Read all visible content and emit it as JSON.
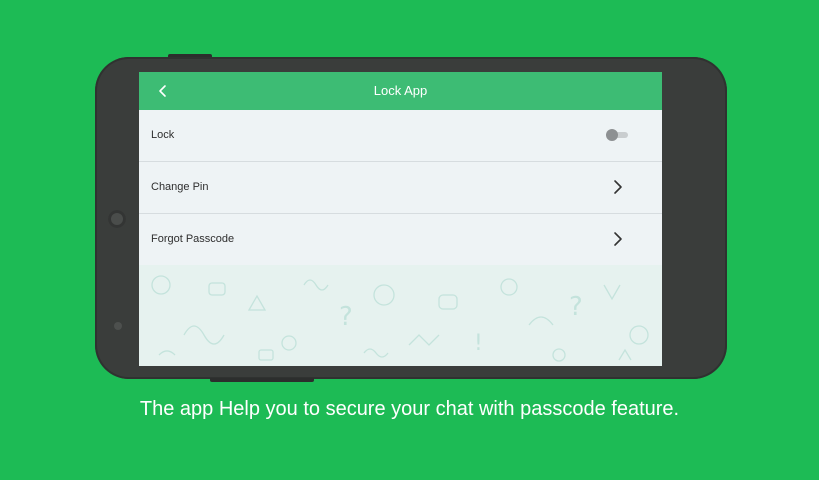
{
  "colors": {
    "background": "#1dbb55",
    "app_bar": "#3dbc74",
    "phone_body": "#3a3d3b"
  },
  "app_bar": {
    "back_icon": "chevron-left-icon",
    "title": "Lock App"
  },
  "settings": {
    "lock": {
      "label": "Lock",
      "enabled": false
    },
    "change_pin": {
      "label": "Change Pin",
      "icon": "chevron-right-icon"
    },
    "forgot_passcode": {
      "label": "Forgot Passcode",
      "icon": "chevron-right-icon"
    }
  },
  "caption": "The app Help you to secure your chat with passcode feature."
}
